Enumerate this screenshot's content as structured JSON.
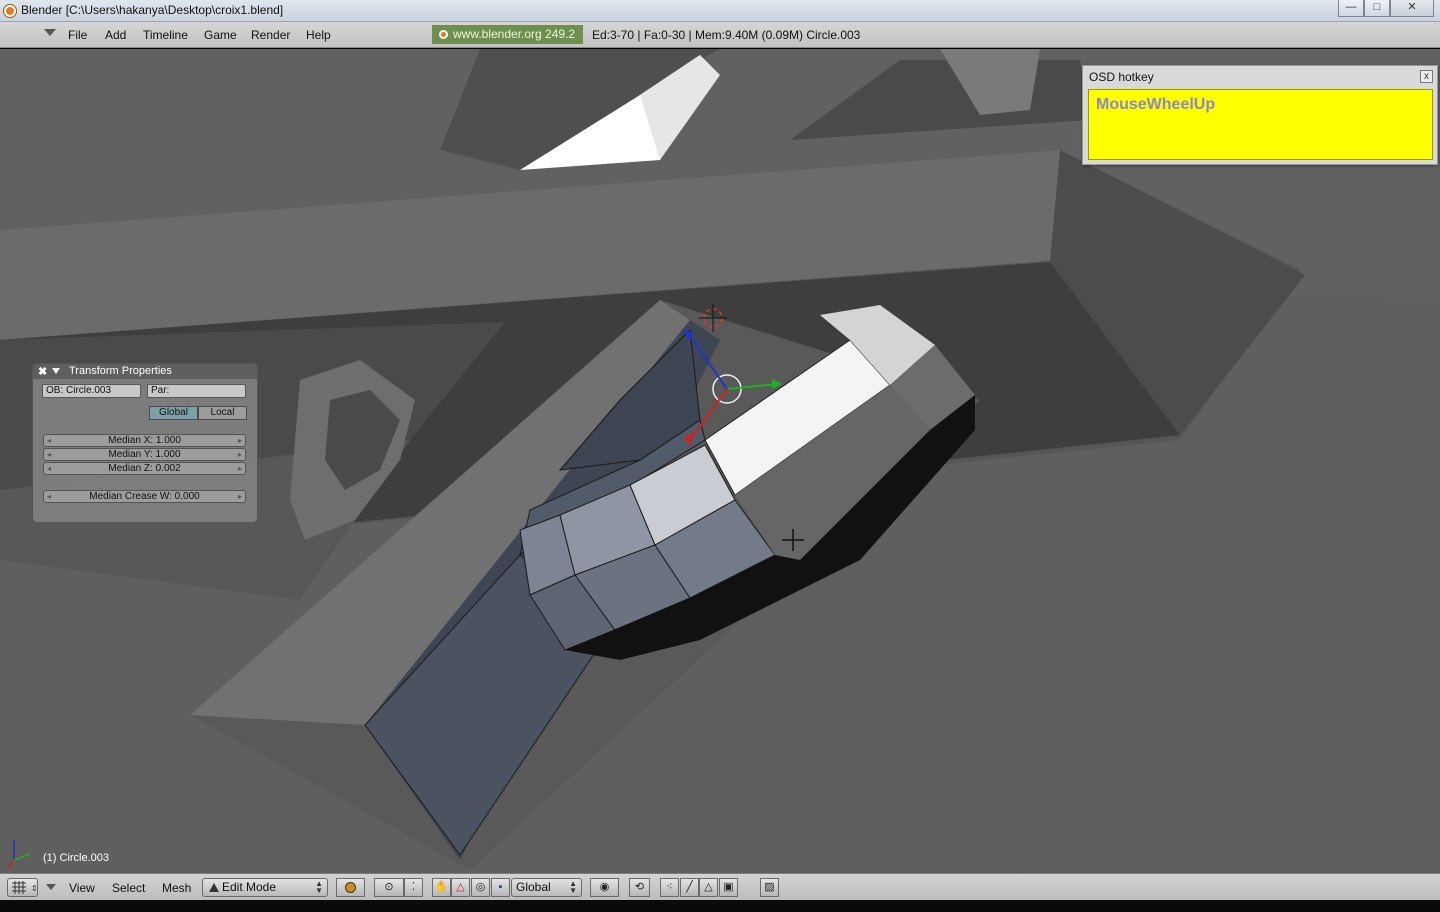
{
  "window": {
    "title": "Blender [C:\\Users\\hakanya\\Desktop\\croix1.blend]",
    "minimize": "—",
    "maximize": "□",
    "close": "✕"
  },
  "menubar": {
    "items": [
      "File",
      "Add",
      "Timeline",
      "Game",
      "Render",
      "Help"
    ],
    "site": "www.blender.org 249.2",
    "stats": "Ed:3-70 | Fa:0-30 | Mem:9.40M (0.09M) Circle.003"
  },
  "osd": {
    "title": "OSD hotkey",
    "close": "x",
    "key": "MouseWheelUp",
    "bg_color": "#ffff00"
  },
  "transform": {
    "title": "Transform Properties",
    "close": "✖",
    "ob": "OB: Circle.003",
    "par": "Par:",
    "global": "Global",
    "local": "Local",
    "median_x": "Median X: 1.000",
    "median_y": "Median Y: 1.000",
    "median_z": "Median Z: 0.002",
    "median_crease": "Median Crease W: 0.000"
  },
  "viewport": {
    "object_label": "(1) Circle.003"
  },
  "bottombar": {
    "menus": [
      "View",
      "Select",
      "Mesh"
    ],
    "mode": "Edit Mode",
    "orientation": "Global"
  }
}
